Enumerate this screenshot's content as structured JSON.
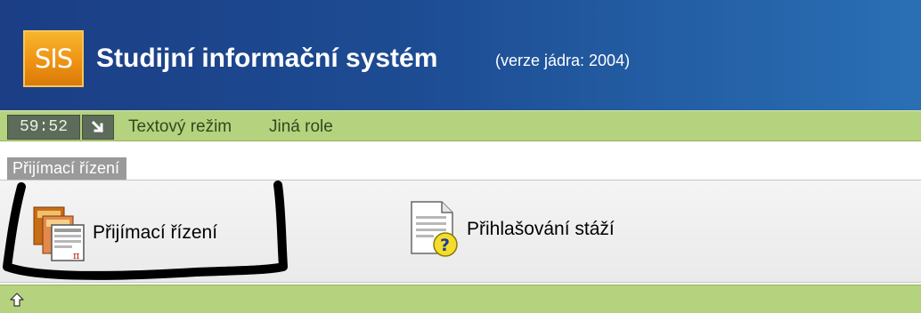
{
  "header": {
    "logo_text": "SIS",
    "title": "Studijní informační systém",
    "version": "(verze jádra: 2004)"
  },
  "toolbar": {
    "timer": "59:52",
    "logout_icon": "logout-arrow-icon",
    "links": [
      "Textový režim",
      "Jiná role"
    ]
  },
  "section": {
    "title": "Přijímací řízení"
  },
  "menu": {
    "items": [
      {
        "label": "Přijímací řízení",
        "icon": "admission-forms-icon"
      },
      {
        "label": "Přihlašování stáží",
        "icon": "document-help-icon"
      }
    ]
  },
  "bottom": {
    "up_icon": "up-arrow-icon"
  },
  "colors": {
    "header_start": "#1b3e85",
    "header_end": "#2a6fb4",
    "logo_orange": "#ef9314",
    "toolbar_green": "#b5d27e",
    "timer_bg": "#5c6b5a",
    "tab_gray": "#9a9a9a"
  }
}
